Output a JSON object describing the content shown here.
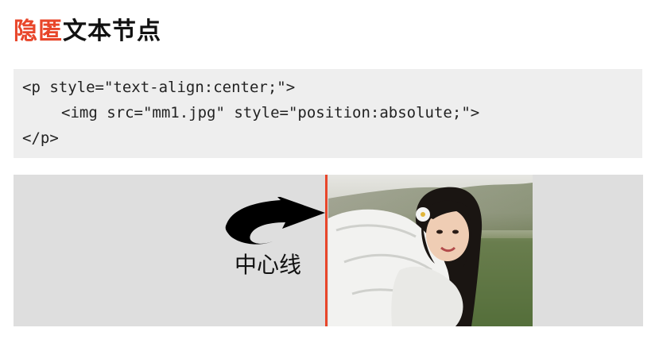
{
  "heading": {
    "accent": "隐匿",
    "rest": "文本节点"
  },
  "code": {
    "lines": [
      "<p style=\"text-align:center;\">",
      "<img src=\"mm1.jpg\" style=\"position:absolute;\">",
      "</p>"
    ]
  },
  "demo": {
    "label": "中心线",
    "line_color": "#e8462a",
    "arrow_icon": "curved-arrow-right-icon",
    "photo_subject": "girl-in-white-jacket-photo"
  },
  "colors": {
    "accent": "#e8462a",
    "code_bg": "#eeeeee",
    "demo_bg": "#dedede"
  }
}
